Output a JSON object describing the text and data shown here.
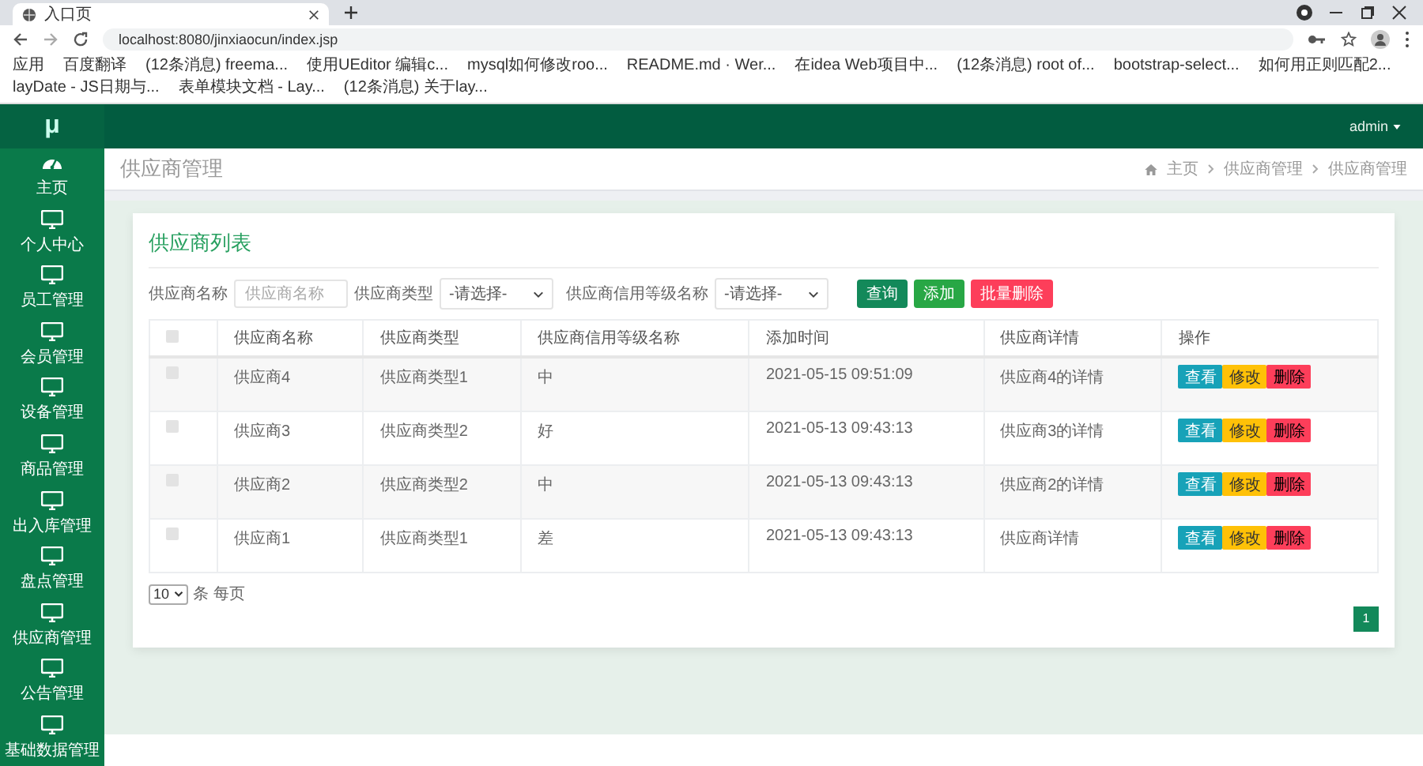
{
  "browser": {
    "tab_title": "入口页",
    "url": "localhost:8080/jinxiaocun/index.jsp",
    "bookmarks": [
      "应用",
      "百度翻译",
      "(12条消息) freema...",
      "使用UEditor 编辑c...",
      "mysql如何修改roo...",
      "README.md · Wer...",
      "在idea Web项目中...",
      "(12条消息) root of...",
      "bootstrap-select...",
      "如何用正则匹配2...",
      "layDate - JS日期与...",
      "表单模块文档 - Lay...",
      "(12条消息) 关于lay..."
    ]
  },
  "app": {
    "logo": "μ",
    "user_menu": "admin"
  },
  "sidebar": {
    "items": [
      {
        "label": "主页",
        "kind": "gauge"
      },
      {
        "label": "个人中心",
        "kind": "monitor"
      },
      {
        "label": "员工管理",
        "kind": "monitor"
      },
      {
        "label": "会员管理",
        "kind": "monitor"
      },
      {
        "label": "设备管理",
        "kind": "monitor"
      },
      {
        "label": "商品管理",
        "kind": "monitor"
      },
      {
        "label": "出入库管理",
        "kind": "monitor"
      },
      {
        "label": "盘点管理",
        "kind": "monitor"
      },
      {
        "label": "供应商管理",
        "kind": "monitor"
      },
      {
        "label": "公告管理",
        "kind": "monitor"
      },
      {
        "label": "基础数据管理",
        "kind": "monitor"
      }
    ]
  },
  "page_header": {
    "title": "供应商管理",
    "breadcrumbs": [
      "主页",
      "供应商管理",
      "供应商管理"
    ]
  },
  "card": {
    "title": "供应商列表",
    "filters": [
      {
        "kind": "input",
        "label": "供应商名称",
        "placeholder": "供应商名称"
      },
      {
        "kind": "select",
        "label": "供应商类型",
        "value": "-请选择-"
      },
      {
        "kind": "select",
        "label": "供应商信用等级名称",
        "value": "-请选择-"
      }
    ],
    "buttons": [
      {
        "label": "查询",
        "kind": "search"
      },
      {
        "label": "添加",
        "kind": "add"
      },
      {
        "label": "批量删除",
        "kind": "delete"
      }
    ],
    "table": {
      "header_checked": false,
      "columns": [
        "供应商名称",
        "供应商类型",
        "供应商信用等级名称",
        "添加时间",
        "供应商详情",
        "操作"
      ],
      "rows": [
        {
          "checked": false,
          "cells": [
            "供应商4",
            "供应商类型1",
            "中",
            "2021-05-15 09:51:09",
            "供应商4的详情"
          ],
          "actions": [
            {
              "label": "查看",
              "kind": "view"
            },
            {
              "label": "修改",
              "kind": "edit"
            },
            {
              "label": "删除",
              "kind": "delete"
            }
          ]
        },
        {
          "checked": false,
          "cells": [
            "供应商3",
            "供应商类型2",
            "好",
            "2021-05-13 09:43:13",
            "供应商3的详情"
          ],
          "actions": [
            {
              "label": "查看",
              "kind": "view"
            },
            {
              "label": "修改",
              "kind": "edit"
            },
            {
              "label": "删除",
              "kind": "delete"
            }
          ]
        },
        {
          "checked": false,
          "cells": [
            "供应商2",
            "供应商类型2",
            "中",
            "2021-05-13 09:43:13",
            "供应商2的详情"
          ],
          "actions": [
            {
              "label": "查看",
              "kind": "view"
            },
            {
              "label": "修改",
              "kind": "edit"
            },
            {
              "label": "删除",
              "kind": "delete"
            }
          ]
        },
        {
          "checked": false,
          "cells": [
            "供应商1",
            "供应商类型1",
            "差",
            "2021-05-13 09:43:13",
            "供应商详情"
          ],
          "actions": [
            {
              "label": "查看",
              "kind": "view"
            },
            {
              "label": "修改",
              "kind": "edit"
            },
            {
              "label": "删除",
              "kind": "delete"
            }
          ]
        }
      ]
    },
    "page_size": "10",
    "page_size_label": "条 每页",
    "pages": [
      {
        "label": "1",
        "selected": true
      }
    ]
  }
}
